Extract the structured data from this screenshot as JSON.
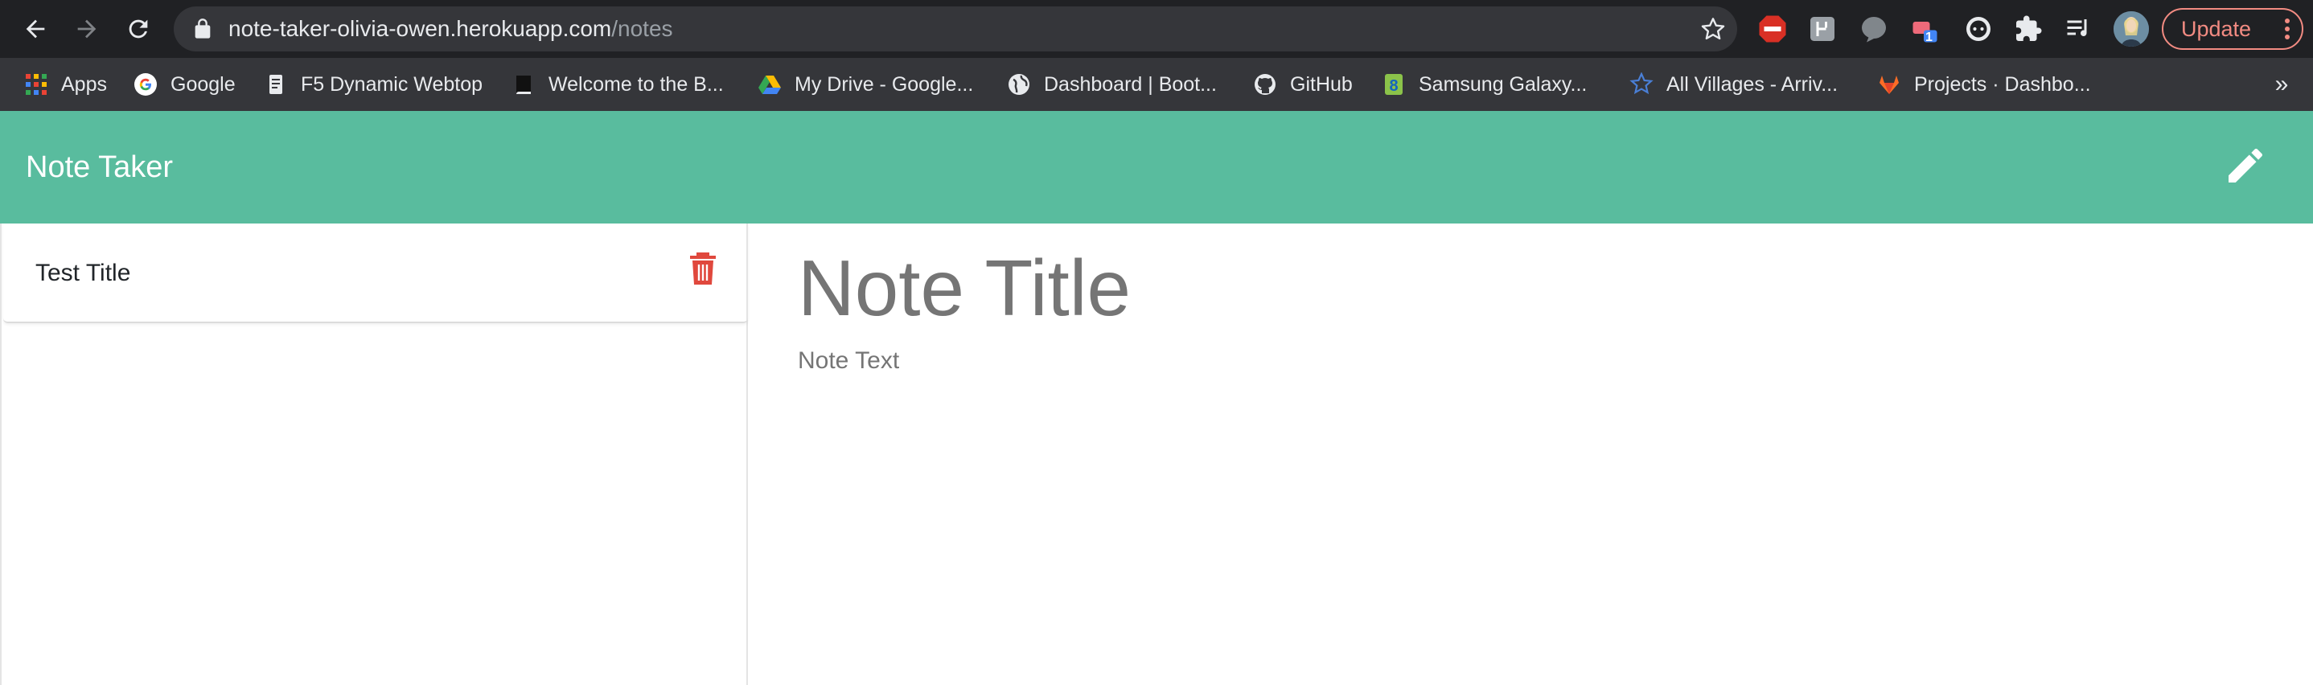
{
  "browser": {
    "url_host": "note-taker-olivia-owen.herokuapp.com",
    "url_path": "/notes",
    "update_label": "Update",
    "extensions": [
      "adblock-icon",
      "grid-extension-icon",
      "speech-bubble-icon",
      "notification-extension-icon",
      "dots-circle-icon",
      "puzzle-icon",
      "reading-list-icon"
    ],
    "extension_badge": "1",
    "update_color": "#f28b82"
  },
  "bookmarks": [
    {
      "label": "Apps",
      "icon": "apps-grid-icon"
    },
    {
      "label": "Google",
      "icon": "google-icon"
    },
    {
      "label": "F5 Dynamic Webtop",
      "icon": "document-icon"
    },
    {
      "label": "Welcome to the B...",
      "icon": "book-icon"
    },
    {
      "label": "My Drive - Google...",
      "icon": "drive-icon"
    },
    {
      "label": "Dashboard | Boot...",
      "icon": "globe-icon"
    },
    {
      "label": "GitHub",
      "icon": "github-icon"
    },
    {
      "label": "Samsung Galaxy...",
      "icon": "samsung-icon"
    },
    {
      "label": "All Villages - Arriv...",
      "icon": "star-outline-icon"
    },
    {
      "label": "Projects · Dashbo...",
      "icon": "gitlab-icon"
    }
  ],
  "app": {
    "brand": "Note Taker",
    "nav_color": "#59bc9e",
    "notes": [
      {
        "title": "Test Title"
      }
    ],
    "editor": {
      "title_placeholder": "Note Title",
      "text_placeholder": "Note Text"
    },
    "delete_color": "#e0483d"
  }
}
